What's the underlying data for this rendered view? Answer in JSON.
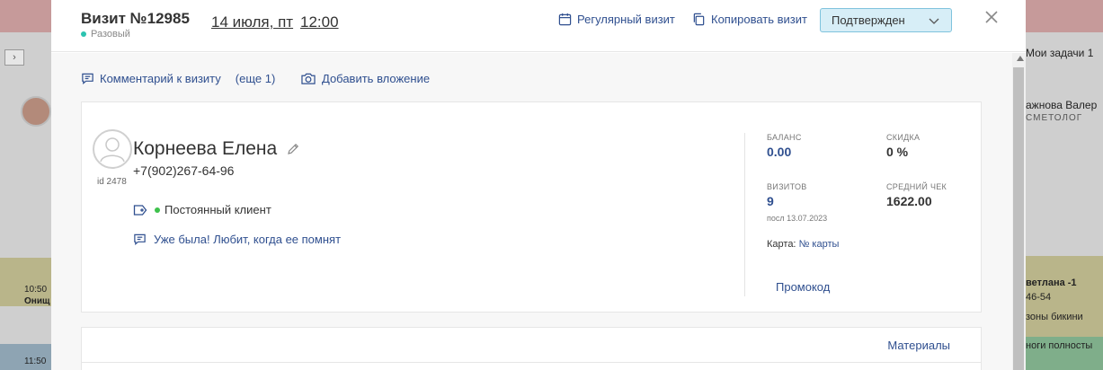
{
  "background": {
    "left_card_time": "10:50 -",
    "left_card_name": "Онищ",
    "left_card2_time": "11:50 -",
    "right_tasks": "Мои задачи 1",
    "right_name": "ажнова Валер",
    "right_role": "СМЕТОЛОГ",
    "right_card_name": "ветлана -1",
    "right_card_phone": "46-54",
    "right_card_service": "зоны бикини",
    "right_card2_service": "ноги полносты"
  },
  "header": {
    "visit_title": "Визит №12985",
    "visit_type": "Разовый",
    "visit_date": "14 июля, пт",
    "visit_time": "12:00",
    "regular_visit": "Регулярный визит",
    "copy_visit": "Копировать визит",
    "status": "Подтвержден"
  },
  "body": {
    "comment_link": "Комментарий к визиту",
    "comment_more": "(еще 1)",
    "add_attachment": "Добавить вложение"
  },
  "client": {
    "name": "Корнеева Елена",
    "phone": "+7(902)267-64-96",
    "id_label": "id 2478",
    "tag": "Постоянный клиент",
    "note": "Уже была! Любит, когда ее помнят"
  },
  "stats": {
    "balance_label": "БАЛАНС",
    "balance_value": "0.00",
    "discount_label": "СКИДКА",
    "discount_value": "0 %",
    "visits_label": "ВИЗИТОВ",
    "visits_value": "9",
    "visits_last": "посл 13.07.2023",
    "avg_check_label": "СРЕДНИЙ ЧЕК",
    "avg_check_value": "1622.00",
    "card_label": "Карта:",
    "card_value": "№ карты",
    "promo": "Промокод"
  },
  "materials": {
    "link": "Материалы"
  },
  "colors": {
    "accent": "#2f4f8f",
    "status_bg": "#d7eef7",
    "status_border": "#7fc3dd",
    "teal_dot": "#2cc3b0",
    "green_dot": "#3ec14c"
  }
}
